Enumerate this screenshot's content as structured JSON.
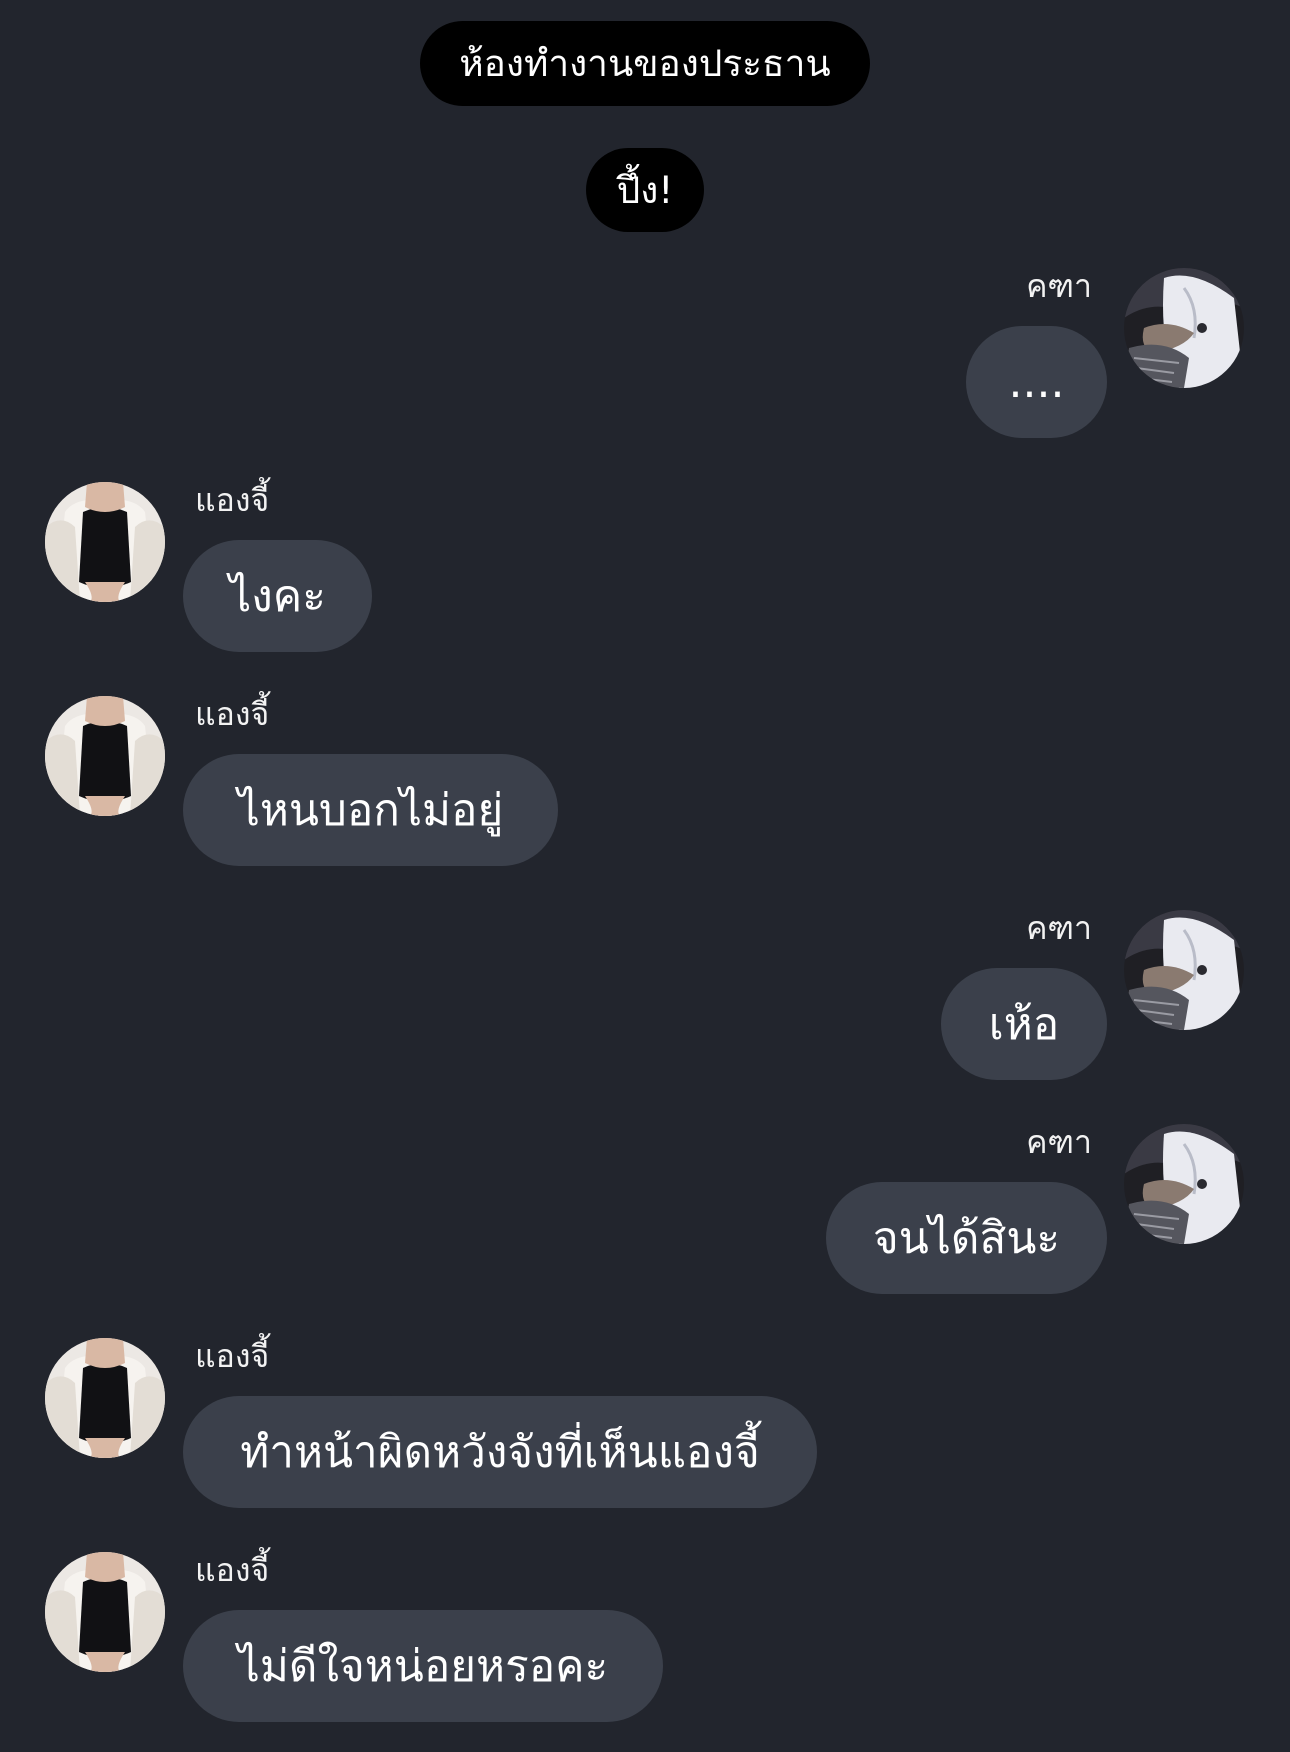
{
  "banners": {
    "room": "ห้องทำงานของประธาน",
    "sound": "ปึ้ง!"
  },
  "participants": {
    "katha": {
      "name": "คฑา",
      "avatar_icon": "man-in-white-shirt-avatar-icon"
    },
    "angie": {
      "name": "แองจี้",
      "avatar_icon": "woman-in-black-dress-avatar-icon"
    }
  },
  "messages": [
    {
      "sender": "คฑา",
      "side": "right",
      "text": "...."
    },
    {
      "sender": "แองจี้",
      "side": "left",
      "text": "ไงคะ"
    },
    {
      "sender": "แองจี้",
      "side": "left",
      "text": "ไหนบอกไม่อยู่"
    },
    {
      "sender": "คฑา",
      "side": "right",
      "text": "เห้อ"
    },
    {
      "sender": "คฑา",
      "side": "right",
      "text": "จนได้สินะ"
    },
    {
      "sender": "แองจี้",
      "side": "left",
      "text": "ทำหน้าผิดหวังจังที่เห็นแองจี้"
    },
    {
      "sender": "แองจี้",
      "side": "left",
      "text": "ไม่ดีใจหน่อยหรอคะ"
    }
  ],
  "colors": {
    "background": "#22252d",
    "bubble": "#3b404b",
    "banner": "#000000",
    "text": "#ffffff"
  }
}
